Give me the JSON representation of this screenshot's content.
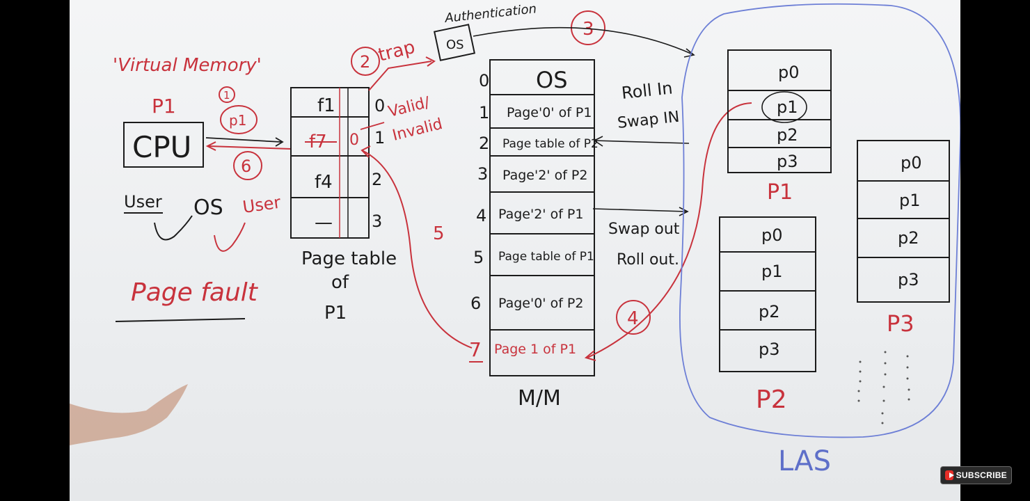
{
  "header": {
    "title": "'Virtual Memory'",
    "auth_label": "Authentication",
    "os_box": "OS",
    "step3": "3"
  },
  "cpu_section": {
    "process": "P1",
    "cpu": "CPU",
    "step1": "1",
    "request": "p1",
    "step6": "6",
    "user1": "User",
    "os": "OS",
    "user2": "User",
    "page_fault": "Page fault"
  },
  "page_table": {
    "rows": [
      {
        "frame": "f1",
        "bit": "",
        "index": "0"
      },
      {
        "frame": "f7",
        "bit": "0",
        "index": "1"
      },
      {
        "frame": "f4",
        "bit": "",
        "index": "2"
      },
      {
        "frame": "—",
        "bit": "",
        "index": "3"
      }
    ],
    "bit_top": "0",
    "caption": [
      "Page table",
      "of",
      "P1"
    ],
    "step2": "2",
    "trap": "trap",
    "valid_invalid": [
      "Valid/",
      "Invalid"
    ],
    "step5": "5"
  },
  "main_memory": {
    "rows": [
      {
        "index": "0",
        "label": "OS"
      },
      {
        "index": "1",
        "label": "Page'0' of P1"
      },
      {
        "index": "2",
        "label": "Page table of P2"
      },
      {
        "index": "3",
        "label": "Page'2' of P2"
      },
      {
        "index": "4",
        "label": "Page'2' of P1"
      },
      {
        "index": "5",
        "label": "Page table of P1"
      },
      {
        "index": "6",
        "label": "Page'0' of P2"
      },
      {
        "index": "7",
        "label": "Page 1 of P1"
      }
    ],
    "caption": "M/M",
    "roll_in": [
      "Roll In",
      "Swap IN"
    ],
    "swap_out": [
      "Swap out",
      "Roll out."
    ],
    "step4": "4"
  },
  "las": {
    "caption": "LAS",
    "p1": {
      "pages": [
        "p0",
        "p1",
        "p2",
        "p3"
      ],
      "label": "P1"
    },
    "p2": {
      "pages": [
        "p0",
        "p1",
        "p2",
        "p3"
      ],
      "label": "P2"
    },
    "p3": {
      "pages": [
        "p0",
        "p1",
        "p2",
        "p3"
      ],
      "label": "P3"
    }
  },
  "subscribe": "SUBSCRIBE",
  "colors": {
    "ink": "#1b1b1b",
    "red": "#c8323c",
    "blue": "#6d7fd6"
  }
}
